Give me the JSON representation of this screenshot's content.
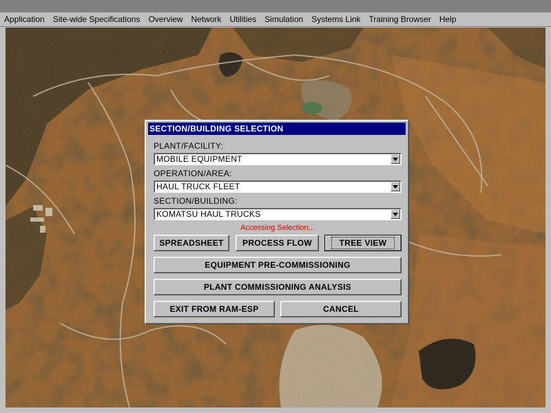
{
  "menu": {
    "items": [
      "Application",
      "Site-wide Specifications",
      "Overview",
      "Network",
      "Utilities",
      "Simulation",
      "Systems Link",
      "Training Browser",
      "Help"
    ]
  },
  "dialog": {
    "title": "SECTION/BUILDING  SELECTION",
    "plant_label": "PLANT/FACILITY:",
    "plant_value": "MOBILE EQUIPMENT",
    "operation_label": "OPERATION/AREA:",
    "operation_value": "HAUL TRUCK FLEET",
    "section_label": "SECTION/BUILDING:",
    "section_value": "KOMATSU HAUL TRUCKS",
    "status": "Accessing Selection...",
    "buttons": {
      "spreadsheet": "SPREADSHEET",
      "process_flow": "PROCESS FLOW",
      "tree_view": "TREE VIEW",
      "pre_commissioning": "EQUIPMENT PRE-COMMISSIONING",
      "commissioning_analysis": "PLANT COMMISSIONING ANALYSIS",
      "exit": "EXIT FROM RAM-ESP",
      "cancel": "CANCEL"
    }
  },
  "colors": {
    "title_bar": "#000080",
    "status_text": "#e00000",
    "window_face": "#c0c0c0"
  }
}
